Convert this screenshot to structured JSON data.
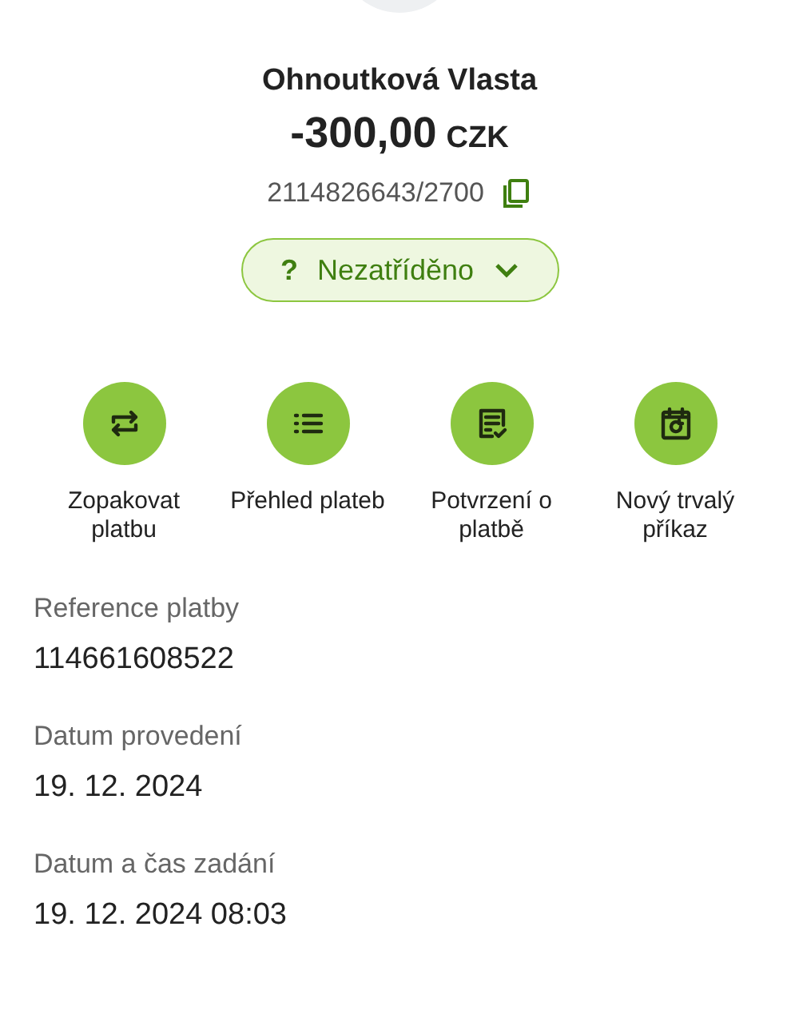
{
  "payee": "Ohnoutková Vlasta",
  "amount": "-300,00",
  "currency": "CZK",
  "account": "2114826643/2700",
  "category": {
    "icon": "?",
    "label": "Nezatříděno"
  },
  "actions": [
    {
      "kind": "repeat",
      "label": "Zopakovat platbu"
    },
    {
      "kind": "list",
      "label": "Přehled plateb"
    },
    {
      "kind": "receipt",
      "label": "Potvrzení o platbě"
    },
    {
      "kind": "calendar",
      "label": "Nový trvalý příkaz"
    }
  ],
  "details": [
    {
      "label": "Reference platby",
      "value": "114661608522"
    },
    {
      "label": "Datum provedení",
      "value": "19. 12. 2024"
    },
    {
      "label": "Datum a čas zadání",
      "value": "19. 12. 2024 08:03"
    }
  ]
}
